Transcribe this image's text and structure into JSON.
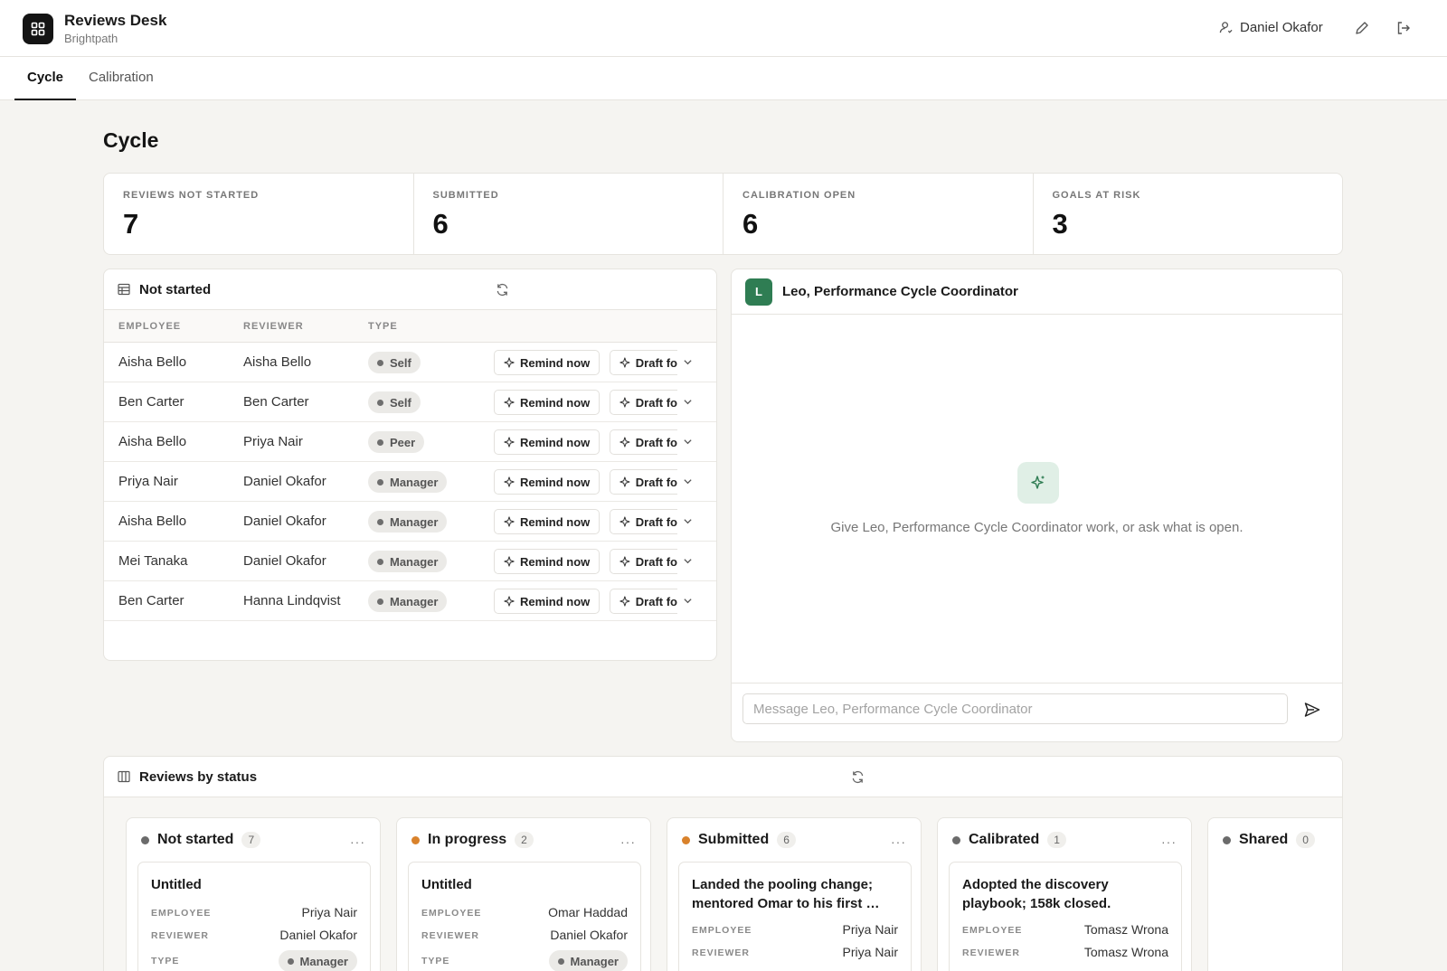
{
  "app": {
    "title": "Reviews Desk",
    "subtitle": "Brightpath"
  },
  "header": {
    "user_name": "Daniel Okafor"
  },
  "tabs": [
    {
      "label": "Cycle"
    },
    {
      "label": "Calibration"
    }
  ],
  "page": {
    "title": "Cycle"
  },
  "stats": [
    {
      "label": "REVIEWS NOT STARTED",
      "value": "7"
    },
    {
      "label": "SUBMITTED",
      "value": "6"
    },
    {
      "label": "CALIBRATION OPEN",
      "value": "6"
    },
    {
      "label": "GOALS AT RISK",
      "value": "3"
    }
  ],
  "not_started": {
    "title": "Not started",
    "columns": [
      "EMPLOYEE",
      "REVIEWER",
      "TYPE"
    ],
    "remind_label": "Remind now",
    "draft_label": "Draft fo",
    "rows": [
      {
        "employee": "Aisha Bello",
        "reviewer": "Aisha Bello",
        "type": "Self"
      },
      {
        "employee": "Ben Carter",
        "reviewer": "Ben Carter",
        "type": "Self"
      },
      {
        "employee": "Aisha Bello",
        "reviewer": "Priya Nair",
        "type": "Peer"
      },
      {
        "employee": "Priya Nair",
        "reviewer": "Daniel Okafor",
        "type": "Manager"
      },
      {
        "employee": "Aisha Bello",
        "reviewer": "Daniel Okafor",
        "type": "Manager"
      },
      {
        "employee": "Mei Tanaka",
        "reviewer": "Daniel Okafor",
        "type": "Manager"
      },
      {
        "employee": "Ben Carter",
        "reviewer": "Hanna Lindqvist",
        "type": "Manager"
      }
    ]
  },
  "chat": {
    "avatar": "L",
    "title": "Leo, Performance Cycle Coordinator",
    "empty_text": "Give Leo, Performance Cycle Coordinator work, or ask what is open.",
    "placeholder": "Message Leo, Performance Cycle Coordinator"
  },
  "board": {
    "title": "Reviews by status",
    "labels": {
      "employee": "EMPLOYEE",
      "reviewer": "REVIEWER",
      "type": "TYPE"
    },
    "columns": [
      {
        "name": "Not started",
        "count": "7",
        "color": "#6b6b6b",
        "card": {
          "title": "Untitled",
          "employee": "Priya Nair",
          "reviewer": "Daniel Okafor",
          "type": "Manager"
        }
      },
      {
        "name": "In progress",
        "count": "2",
        "color": "#d9822b",
        "card": {
          "title": "Untitled",
          "employee": "Omar Haddad",
          "reviewer": "Daniel Okafor",
          "type": "Manager"
        }
      },
      {
        "name": "Submitted",
        "count": "6",
        "color": "#d9822b",
        "card": {
          "title": "Landed the pooling change; mentored Omar to his first …",
          "employee": "Priya Nair",
          "reviewer": "Priya Nair"
        }
      },
      {
        "name": "Calibrated",
        "count": "1",
        "color": "#6b6b6b",
        "card": {
          "title": "Adopted the discovery playbook; 158k closed.",
          "employee": "Tomasz Wrona",
          "reviewer": "Tomasz Wrona"
        }
      },
      {
        "name": "Shared",
        "count": "0",
        "color": "#6b6b6b"
      }
    ]
  }
}
